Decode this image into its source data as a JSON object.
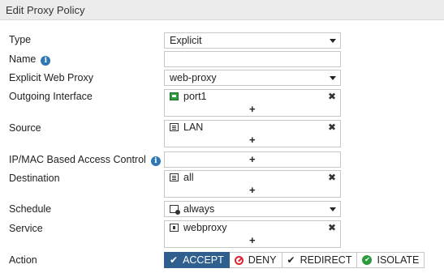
{
  "header": {
    "title": "Edit Proxy Policy"
  },
  "form": {
    "type": {
      "label": "Type",
      "value": "Explicit"
    },
    "name": {
      "label": "Name",
      "value": ""
    },
    "explicit_web_proxy": {
      "label": "Explicit Web Proxy",
      "value": "web-proxy"
    },
    "outgoing_interface": {
      "label": "Outgoing Interface",
      "entry": "port1"
    },
    "source": {
      "label": "Source",
      "entry": "LAN"
    },
    "ipmac_access_control": {
      "label": "IP/MAC Based Access Control"
    },
    "destination": {
      "label": "Destination",
      "entry": "all"
    },
    "schedule": {
      "label": "Schedule",
      "value": "always"
    },
    "service": {
      "label": "Service",
      "entry": "webproxy"
    },
    "action": {
      "label": "Action",
      "options": [
        "ACCEPT",
        "DENY",
        "REDIRECT",
        "ISOLATE"
      ],
      "selected": "ACCEPT"
    },
    "plus_symbol": "+",
    "remove_symbol": "✖",
    "info_symbol": "i"
  },
  "colors": {
    "accent": "#2f5f8e",
    "info": "#2f77b7",
    "deny": "#dd2233",
    "isolate": "#2e9a3e"
  }
}
